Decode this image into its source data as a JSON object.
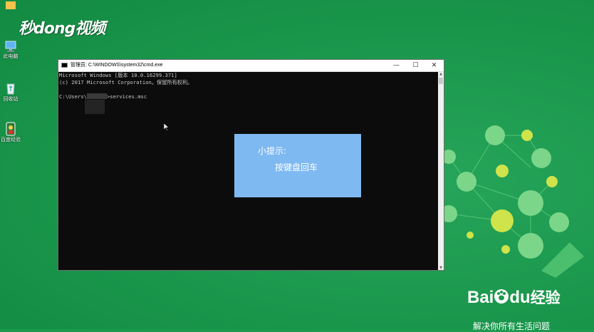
{
  "desktop": {
    "icons": [
      {
        "label": "此电脑",
        "icon": "computer-icon"
      },
      {
        "label": "回收站",
        "icon": "recycle-bin-icon"
      },
      {
        "label": "百度经验",
        "icon": "app-shortcut-icon"
      }
    ],
    "watermark": "秒dong视频"
  },
  "window": {
    "title": "管理员: C:\\WINDOWS\\system32\\cmd.exe",
    "controls": {
      "minimize": "—",
      "maximize": "☐",
      "close": "✕"
    },
    "console": {
      "line1": "Microsoft Windows [版本 10.0.16299.371]",
      "line2": "(c) 2017 Microsoft Corporation。保留所有权利。",
      "prompt_prefix": "C:\\Users\\",
      "prompt_suffix": ">services.msc"
    }
  },
  "tip": {
    "title": "小提示:",
    "body": "按键盘回车"
  },
  "branding": {
    "logo_latin_1": "Bai",
    "logo_latin_2": "du",
    "logo_cn": "经验",
    "slogan": "解决你所有生活问题"
  },
  "colors": {
    "desktop_bg": "#1b9a4e",
    "console_bg": "#0c0c0c",
    "tip_bg": "#7eb9f2"
  }
}
